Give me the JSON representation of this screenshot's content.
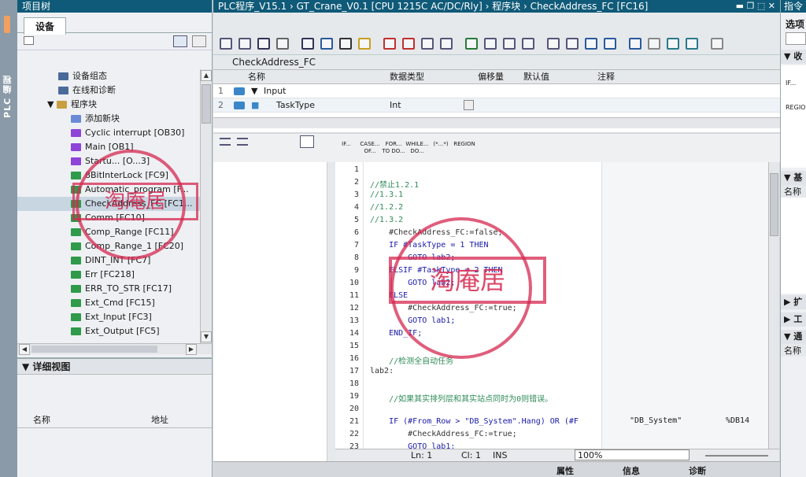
{
  "left_strip": {
    "label": "PLC 编程"
  },
  "project_tree": {
    "title": "项目树",
    "tab": "设备",
    "items": [
      {
        "label": "设备组态",
        "kind": "config"
      },
      {
        "label": "在线和诊断",
        "kind": "online"
      },
      {
        "label": "程序块",
        "kind": "folder"
      },
      {
        "label": "添加新块",
        "kind": "add"
      },
      {
        "label": "Cyclic interrupt [OB30]",
        "kind": "ob"
      },
      {
        "label": "Main [OB1]",
        "kind": "ob"
      },
      {
        "label": "Startu... [O...3]",
        "kind": "ob"
      },
      {
        "label": "8BitInterLock [FC9]",
        "kind": "fc"
      },
      {
        "label": "Automatic_program [F...",
        "kind": "fc"
      },
      {
        "label": "CheckAddress_FC [FC1...",
        "kind": "fc",
        "selected": true
      },
      {
        "label": "Comm [FC10]",
        "kind": "fc"
      },
      {
        "label": "Comp_Range [FC11]",
        "kind": "fc"
      },
      {
        "label": "Comp_Range_1 [FC20]",
        "kind": "fc"
      },
      {
        "label": "DINT_INT [FC7]",
        "kind": "fc"
      },
      {
        "label": "Err [FC218]",
        "kind": "fc"
      },
      {
        "label": "ERR_TO_STR [FC17]",
        "kind": "fc"
      },
      {
        "label": "Ext_Cmd [FC15]",
        "kind": "fc"
      },
      {
        "label": "Ext_Input [FC3]",
        "kind": "fc"
      },
      {
        "label": "Ext_Output [FC5]",
        "kind": "fc"
      }
    ]
  },
  "detail_view": {
    "title": "详细视图",
    "col_name": "名称",
    "col_address": "地址"
  },
  "editor": {
    "breadcrumb": "PLC程序_V15.1  ›  GT_Crane_V0.1 [CPU 1215C AC/DC/Rly]  ›  程序块  ›  CheckAddress_FC [FC16]",
    "block_name": "CheckAddress_FC"
  },
  "interface": {
    "headers": [
      "名称",
      "数据类型",
      "偏移量",
      "默认值",
      "注释"
    ],
    "rows": [
      {
        "num": "1",
        "name": "Input",
        "type": ""
      },
      {
        "num": "2",
        "name": "TaskType",
        "type": "Int"
      }
    ]
  },
  "instr_buttons": [
    "IF...",
    "CASE... OF...",
    "FOR... TO DO...",
    "WHILE... DO...",
    "(*...*)",
    "REGION"
  ],
  "code": {
    "lines": [
      {
        "n": "1",
        "t": ""
      },
      {
        "n": "2",
        "t": "//禁止1.2.1",
        "c": "#2e8b57"
      },
      {
        "n": "3",
        "t": "//1.3.1",
        "c": "#2e8b57"
      },
      {
        "n": "4",
        "t": "//1.2.2",
        "c": "#2e8b57"
      },
      {
        "n": "5",
        "t": "//1.3.2",
        "c": "#2e8b57"
      },
      {
        "n": "6",
        "t": "    #CheckAddress_FC:=false;",
        "c": "#333"
      },
      {
        "n": "7",
        "t": "    IF #TaskType = 1 THEN",
        "c": "#1a1aa8"
      },
      {
        "n": "8",
        "t": "        GOTO lab2;",
        "c": "#1a1aa8"
      },
      {
        "n": "9",
        "t": "    ELSIF #TaskType = 2 THEN",
        "c": "#1a1aa8"
      },
      {
        "n": "10",
        "t": "        GOTO lab2;",
        "c": "#1a1aa8"
      },
      {
        "n": "11",
        "t": "    ELSE",
        "c": "#1a1aa8"
      },
      {
        "n": "12",
        "t": "        #CheckAddress_FC:=true;",
        "c": "#333"
      },
      {
        "n": "13",
        "t": "        GOTO lab1;",
        "c": "#1a1aa8"
      },
      {
        "n": "14",
        "t": "    END_IF;",
        "c": "#1a1aa8"
      },
      {
        "n": "15",
        "t": ""
      },
      {
        "n": "16",
        "t": "    //检测全自动任务",
        "c": "#2e8b57"
      },
      {
        "n": "17",
        "t": "lab2:",
        "c": "#333"
      },
      {
        "n": "18",
        "t": ""
      },
      {
        "n": "19",
        "t": "    //如果其实排列层和其实站点同时为0则错误。",
        "c": "#2e8b57"
      },
      {
        "n": "20",
        "t": ""
      },
      {
        "n": "21",
        "t": "    IF (#From_Row > \"DB_System\".Hang) OR (#F",
        "c": "#1a1aa8"
      },
      {
        "n": "22",
        "t": "        #CheckAddress_FC:=true;",
        "c": "#333"
      },
      {
        "n": "23",
        "t": "        GOTO lab1;",
        "c": "#1a1aa8"
      }
    ],
    "side_db": "\"DB_System\"",
    "side_addr": "%DB14"
  },
  "status": {
    "ln": "Ln: 1",
    "cl": "Cl: 1",
    "ins": "INS",
    "zoom": "100%"
  },
  "right_panel": {
    "title": "指令",
    "options": "选项",
    "section1": "收",
    "text1": "IF...",
    "text2": "REGION",
    "section2": "基",
    "col": "名称",
    "section3": "扩",
    "section4": "工",
    "section5": "通",
    "col2": "名称"
  },
  "bottom_tabs": {
    "props": "属性",
    "info": "信息",
    "diag": "诊断"
  },
  "watermark": {
    "text": "淘庵居",
    "ring": "checked"
  }
}
